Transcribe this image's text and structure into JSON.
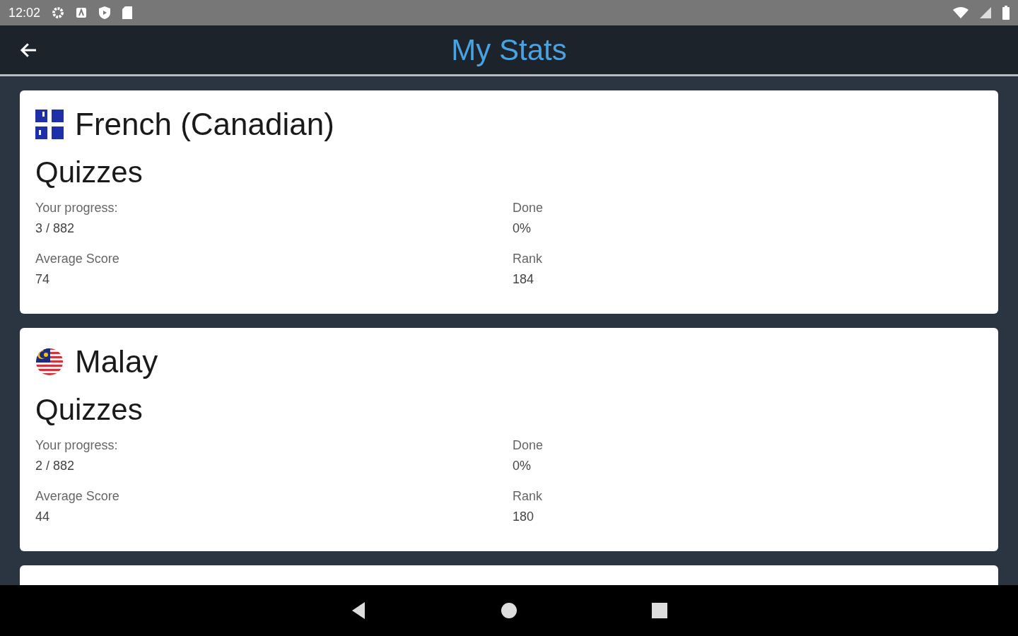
{
  "status_bar": {
    "time": "12:02"
  },
  "toolbar": {
    "title": "My Stats"
  },
  "languages": [
    {
      "name": "French (Canadian)",
      "kind": "quebec",
      "section": "Quizzes",
      "stats": [
        {
          "label": "Your progress:",
          "value": "3 / 882"
        },
        {
          "label": "Done",
          "value": "0%"
        },
        {
          "label": "Average Score",
          "value": "74"
        },
        {
          "label": "Rank",
          "value": "184"
        }
      ]
    },
    {
      "name": "Malay",
      "kind": "malaysia",
      "section": "Quizzes",
      "stats": [
        {
          "label": "Your progress:",
          "value": "2 / 882"
        },
        {
          "label": "Done",
          "value": "0%"
        },
        {
          "label": "Average Score",
          "value": "44"
        },
        {
          "label": "Rank",
          "value": "180"
        }
      ]
    }
  ]
}
